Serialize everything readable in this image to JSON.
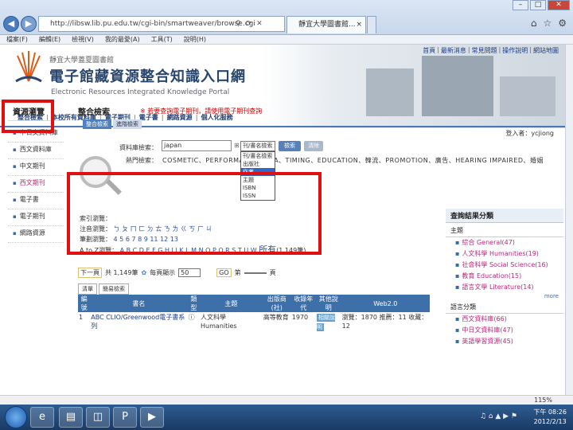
{
  "browser": {
    "url": "http://libsw.lib.pu.edu.tw/cgi-bin/smartweaver/browse.cgi",
    "tab_title": "靜宜大學圖書館...",
    "tab_close": "×",
    "menu": [
      "檔案(F)",
      "編輯(E)",
      "檢視(V)",
      "我的最愛(A)",
      "工具(T)",
      "說明(H)"
    ],
    "zoom": "115%"
  },
  "header": {
    "top_links": [
      "首頁",
      "最新消息",
      "常見問題",
      "操作說明",
      "網站地圖"
    ],
    "library_name": "靜宜大學蓋夏圖書館",
    "portal_title": "電子館藏資源整合知識入口網",
    "portal_subtitle": "Electronic Resources Integrated Knowledge Portal",
    "login_label": "登入者：",
    "login_user": "ycjiong"
  },
  "nav": {
    "items": [
      "整合檢索",
      "本校所有資料庫",
      "電子期刊",
      "電子書",
      "網路資源",
      "個人化服務"
    ]
  },
  "sidebar": {
    "title": "資源瀏覽",
    "items": [
      "中日文資料庫",
      "西文資料庫",
      "中文期刊",
      "西文期刊",
      "電子書",
      "電子期刊",
      "網路資源"
    ]
  },
  "main": {
    "title": "整合檢索",
    "notice": "※ 若要查詢電子期刊，請使用電子期刊查詢",
    "subtabs": [
      "整合檢索",
      "進階檢索"
    ],
    "search": {
      "label": "資料庫檢索：",
      "value": "japan",
      "field": "刊/書名檢索",
      "search_button": "檢索",
      "clear_button": "清除",
      "hot_label": "熱門檢索：",
      "hot_keywords": "COSMETIC、PERFORMANCE、TEA、TIMING、EDUCATION、韓流、PROMOTION、廣告、HEARING IMPAIRED、婚姻",
      "options": [
        "刊/書名檢索",
        "出版社",
        "作者",
        "主題",
        "ISBN",
        "ISSN"
      ]
    },
    "index": {
      "heading": "索引瀏覽：",
      "zhuyin_label": "注音瀏覽：",
      "zhuyin": "ㄅ ㄆ ㄇ ㄈ ㄉ ㄊ ㄋ ㄌ ㄍ ㄎ ㄏ ㄐ",
      "stroke_label": "筆劃瀏覽：",
      "stroke": "4 5 6 7 8 9 11 12 13",
      "alpha_label": "A to Z瀏覽：",
      "alpha": "A B C D E F G H I J K L M N O P Q R S T U W",
      "all_link": "所有",
      "count": "(1,149筆)"
    },
    "pager": {
      "prev": "下一頁",
      "page_info": "共 1,149筆",
      "per_page_label": "每頁顯示",
      "per_page": "50",
      "goto_label": "第",
      "goto_button": "GO",
      "page_suffix": "頁"
    },
    "view_tabs": [
      "清單",
      "簡易檢索"
    ],
    "table": {
      "headers": [
        "編號",
        "書名",
        "類型",
        "主題",
        "出版商(社)",
        "收錄年代",
        "其他說明",
        "Web2.0"
      ],
      "rows": [
        {
          "no": "1",
          "title": "ABC CLIO/Greenwood電子書系列",
          "type": "ⓘ",
          "subject": "人文科學 Humanities",
          "publisher": "高等教育",
          "years": "1970",
          "note": "相關說明",
          "web": "瀏覽：1870 推薦：11 收藏：12"
        }
      ]
    }
  },
  "right_panel": {
    "title": "查詢結果分類",
    "subject_head": "主題",
    "subjects": [
      "綜合 General(47)",
      "人文科學 Humanities(19)",
      "社會科學 Social Science(16)",
      "教育 Education(15)",
      "語言文學 Literature(14)"
    ],
    "more": "more",
    "lang_head": "語言分類",
    "langs": [
      "西文資料庫(66)",
      "中日文資料庫(47)",
      "英語學習資源(45)"
    ]
  },
  "taskbar": {
    "time": "下午 08:26",
    "date": "2012/2/13",
    "tray": "♫ ⌂ ▲ ▶ ⚑"
  }
}
